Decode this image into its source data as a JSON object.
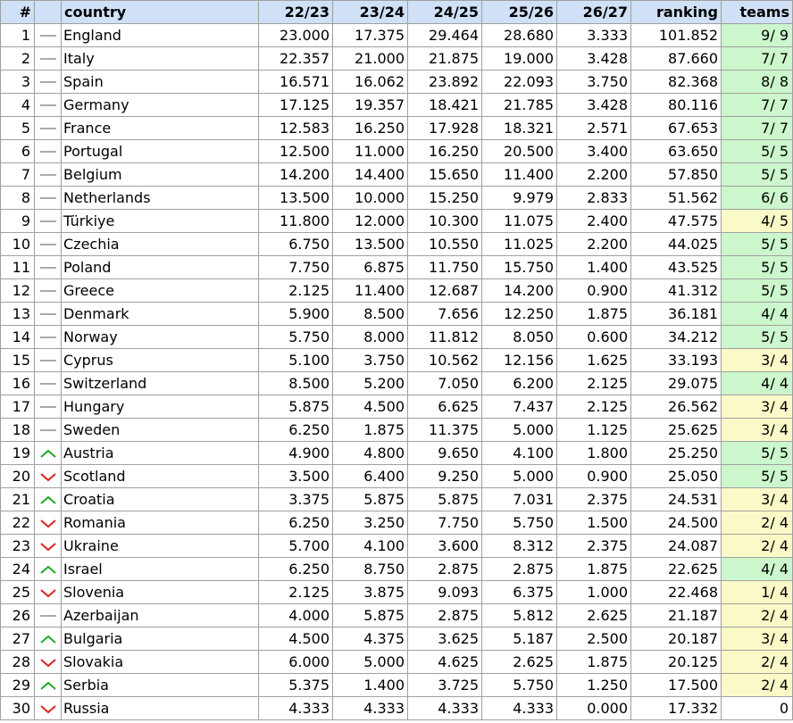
{
  "columns": [
    "#",
    "",
    "country",
    "22/23",
    "23/24",
    "24/25",
    "25/26",
    "26/27",
    "ranking",
    "teams"
  ],
  "colors": {
    "header": "#cfe0f7",
    "green": "#ccf6cc",
    "yellow": "#fafac8",
    "up": "#22aa22",
    "down": "#dd2222",
    "same": "#aaaaaa"
  },
  "rows": [
    {
      "rank": "1",
      "trend": "same",
      "country": "England",
      "s1": "23.000",
      "s2": "17.375",
      "s3": "29.464",
      "s4": "28.680",
      "s5": "3.333",
      "ranking": "101.852",
      "teams": "9/ 9",
      "tc": "green"
    },
    {
      "rank": "2",
      "trend": "same",
      "country": "Italy",
      "s1": "22.357",
      "s2": "21.000",
      "s3": "21.875",
      "s4": "19.000",
      "s5": "3.428",
      "ranking": "87.660",
      "teams": "7/ 7",
      "tc": "green"
    },
    {
      "rank": "3",
      "trend": "same",
      "country": "Spain",
      "s1": "16.571",
      "s2": "16.062",
      "s3": "23.892",
      "s4": "22.093",
      "s5": "3.750",
      "ranking": "82.368",
      "teams": "8/ 8",
      "tc": "green"
    },
    {
      "rank": "4",
      "trend": "same",
      "country": "Germany",
      "s1": "17.125",
      "s2": "19.357",
      "s3": "18.421",
      "s4": "21.785",
      "s5": "3.428",
      "ranking": "80.116",
      "teams": "7/ 7",
      "tc": "green"
    },
    {
      "rank": "5",
      "trend": "same",
      "country": "France",
      "s1": "12.583",
      "s2": "16.250",
      "s3": "17.928",
      "s4": "18.321",
      "s5": "2.571",
      "ranking": "67.653",
      "teams": "7/ 7",
      "tc": "green"
    },
    {
      "rank": "6",
      "trend": "same",
      "country": "Portugal",
      "s1": "12.500",
      "s2": "11.000",
      "s3": "16.250",
      "s4": "20.500",
      "s5": "3.400",
      "ranking": "63.650",
      "teams": "5/ 5",
      "tc": "green"
    },
    {
      "rank": "7",
      "trend": "same",
      "country": "Belgium",
      "s1": "14.200",
      "s2": "14.400",
      "s3": "15.650",
      "s4": "11.400",
      "s5": "2.200",
      "ranking": "57.850",
      "teams": "5/ 5",
      "tc": "green"
    },
    {
      "rank": "8",
      "trend": "same",
      "country": "Netherlands",
      "s1": "13.500",
      "s2": "10.000",
      "s3": "15.250",
      "s4": "9.979",
      "s5": "2.833",
      "ranking": "51.562",
      "teams": "6/ 6",
      "tc": "green"
    },
    {
      "rank": "9",
      "trend": "same",
      "country": "Türkiye",
      "s1": "11.800",
      "s2": "12.000",
      "s3": "10.300",
      "s4": "11.075",
      "s5": "2.400",
      "ranking": "47.575",
      "teams": "4/ 5",
      "tc": "yellow"
    },
    {
      "rank": "10",
      "trend": "same",
      "country": "Czechia",
      "s1": "6.750",
      "s2": "13.500",
      "s3": "10.550",
      "s4": "11.025",
      "s5": "2.200",
      "ranking": "44.025",
      "teams": "5/ 5",
      "tc": "green"
    },
    {
      "rank": "11",
      "trend": "same",
      "country": "Poland",
      "s1": "7.750",
      "s2": "6.875",
      "s3": "11.750",
      "s4": "15.750",
      "s5": "1.400",
      "ranking": "43.525",
      "teams": "5/ 5",
      "tc": "green"
    },
    {
      "rank": "12",
      "trend": "same",
      "country": "Greece",
      "s1": "2.125",
      "s2": "11.400",
      "s3": "12.687",
      "s4": "14.200",
      "s5": "0.900",
      "ranking": "41.312",
      "teams": "5/ 5",
      "tc": "green"
    },
    {
      "rank": "13",
      "trend": "same",
      "country": "Denmark",
      "s1": "5.900",
      "s2": "8.500",
      "s3": "7.656",
      "s4": "12.250",
      "s5": "1.875",
      "ranking": "36.181",
      "teams": "4/ 4",
      "tc": "green"
    },
    {
      "rank": "14",
      "trend": "same",
      "country": "Norway",
      "s1": "5.750",
      "s2": "8.000",
      "s3": "11.812",
      "s4": "8.050",
      "s5": "0.600",
      "ranking": "34.212",
      "teams": "5/ 5",
      "tc": "green"
    },
    {
      "rank": "15",
      "trend": "same",
      "country": "Cyprus",
      "s1": "5.100",
      "s2": "3.750",
      "s3": "10.562",
      "s4": "12.156",
      "s5": "1.625",
      "ranking": "33.193",
      "teams": "3/ 4",
      "tc": "yellow"
    },
    {
      "rank": "16",
      "trend": "same",
      "country": "Switzerland",
      "s1": "8.500",
      "s2": "5.200",
      "s3": "7.050",
      "s4": "6.200",
      "s5": "2.125",
      "ranking": "29.075",
      "teams": "4/ 4",
      "tc": "green"
    },
    {
      "rank": "17",
      "trend": "same",
      "country": "Hungary",
      "s1": "5.875",
      "s2": "4.500",
      "s3": "6.625",
      "s4": "7.437",
      "s5": "2.125",
      "ranking": "26.562",
      "teams": "3/ 4",
      "tc": "yellow"
    },
    {
      "rank": "18",
      "trend": "same",
      "country": "Sweden",
      "s1": "6.250",
      "s2": "1.875",
      "s3": "11.375",
      "s4": "5.000",
      "s5": "1.125",
      "ranking": "25.625",
      "teams": "3/ 4",
      "tc": "yellow"
    },
    {
      "rank": "19",
      "trend": "up",
      "country": "Austria",
      "s1": "4.900",
      "s2": "4.800",
      "s3": "9.650",
      "s4": "4.100",
      "s5": "1.800",
      "ranking": "25.250",
      "teams": "5/ 5",
      "tc": "green"
    },
    {
      "rank": "20",
      "trend": "down",
      "country": "Scotland",
      "s1": "3.500",
      "s2": "6.400",
      "s3": "9.250",
      "s4": "5.000",
      "s5": "0.900",
      "ranking": "25.050",
      "teams": "5/ 5",
      "tc": "green"
    },
    {
      "rank": "21",
      "trend": "up",
      "country": "Croatia",
      "s1": "3.375",
      "s2": "5.875",
      "s3": "5.875",
      "s4": "7.031",
      "s5": "2.375",
      "ranking": "24.531",
      "teams": "3/ 4",
      "tc": "yellow"
    },
    {
      "rank": "22",
      "trend": "down",
      "country": "Romania",
      "s1": "6.250",
      "s2": "3.250",
      "s3": "7.750",
      "s4": "5.750",
      "s5": "1.500",
      "ranking": "24.500",
      "teams": "2/ 4",
      "tc": "yellow"
    },
    {
      "rank": "23",
      "trend": "down",
      "country": "Ukraine",
      "s1": "5.700",
      "s2": "4.100",
      "s3": "3.600",
      "s4": "8.312",
      "s5": "2.375",
      "ranking": "24.087",
      "teams": "2/ 4",
      "tc": "yellow"
    },
    {
      "rank": "24",
      "trend": "up",
      "country": "Israel",
      "s1": "6.250",
      "s2": "8.750",
      "s3": "2.875",
      "s4": "2.875",
      "s5": "1.875",
      "ranking": "22.625",
      "teams": "4/ 4",
      "tc": "green"
    },
    {
      "rank": "25",
      "trend": "down",
      "country": "Slovenia",
      "s1": "2.125",
      "s2": "3.875",
      "s3": "9.093",
      "s4": "6.375",
      "s5": "1.000",
      "ranking": "22.468",
      "teams": "1/ 4",
      "tc": "yellow"
    },
    {
      "rank": "26",
      "trend": "same",
      "country": "Azerbaijan",
      "s1": "4.000",
      "s2": "5.875",
      "s3": "2.875",
      "s4": "5.812",
      "s5": "2.625",
      "ranking": "21.187",
      "teams": "2/ 4",
      "tc": "yellow"
    },
    {
      "rank": "27",
      "trend": "up",
      "country": "Bulgaria",
      "s1": "4.500",
      "s2": "4.375",
      "s3": "3.625",
      "s4": "5.187",
      "s5": "2.500",
      "ranking": "20.187",
      "teams": "3/ 4",
      "tc": "yellow"
    },
    {
      "rank": "28",
      "trend": "down",
      "country": "Slovakia",
      "s1": "6.000",
      "s2": "5.000",
      "s3": "4.625",
      "s4": "2.625",
      "s5": "1.875",
      "ranking": "20.125",
      "teams": "2/ 4",
      "tc": "yellow"
    },
    {
      "rank": "29",
      "trend": "up",
      "country": "Serbia",
      "s1": "5.375",
      "s2": "1.400",
      "s3": "3.725",
      "s4": "5.750",
      "s5": "1.250",
      "ranking": "17.500",
      "teams": "2/ 4",
      "tc": "yellow"
    },
    {
      "rank": "30",
      "trend": "down",
      "country": "Russia",
      "s1": "4.333",
      "s2": "4.333",
      "s3": "4.333",
      "s4": "4.333",
      "s5": "0.000",
      "ranking": "17.332",
      "teams": "0",
      "tc": "white"
    }
  ]
}
